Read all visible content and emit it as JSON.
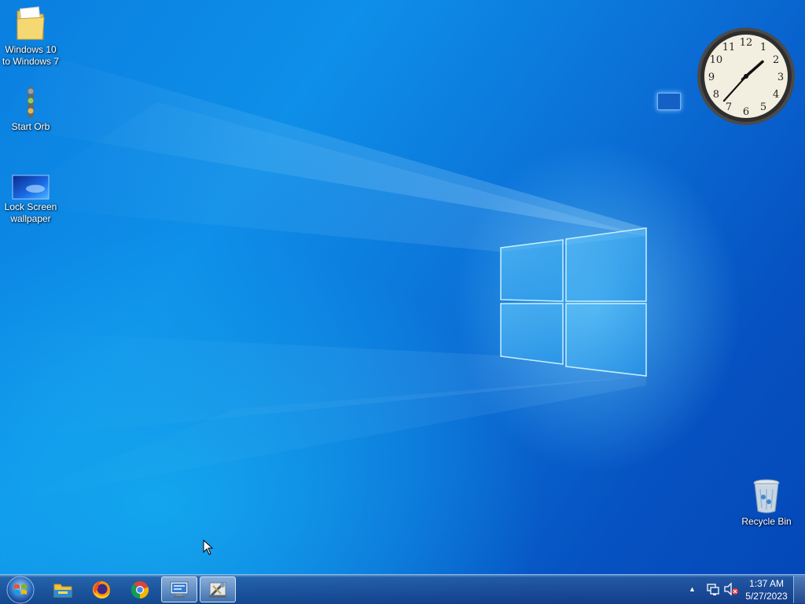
{
  "desktop": {
    "icons": [
      {
        "label": "Windows 10\nto Windows 7",
        "icon": "folder-icon"
      },
      {
        "label": "Start Orb",
        "icon": "traffic-light-icon"
      },
      {
        "label": "Lock Screen\nwallpaper",
        "icon": "image-thumbnail-icon"
      },
      {
        "label": "Recycle Bin",
        "icon": "recycle-bin-icon"
      }
    ]
  },
  "clock_gadget": {
    "numerals": [
      "12",
      "1",
      "2",
      "3",
      "4",
      "5",
      "6",
      "7",
      "8",
      "9",
      "10",
      "11"
    ],
    "hour": 1,
    "minute": 37
  },
  "taskbar": {
    "start_icon": "start-orb-icon",
    "pinned": [
      {
        "name": "File Explorer",
        "icon": "folder-icon"
      },
      {
        "name": "Firefox",
        "icon": "firefox-icon"
      },
      {
        "name": "Chrome",
        "icon": "chrome-icon"
      },
      {
        "name": "Remote Desktop",
        "icon": "remote-desktop-icon"
      },
      {
        "name": "Tools",
        "icon": "tools-icon"
      }
    ],
    "tray": {
      "time": "1:37 AM",
      "date": "5/27/2023",
      "icons": [
        "show-hidden-icon",
        "network-icon",
        "volume-muted-icon"
      ]
    }
  },
  "colors": {
    "wallpaper_dark": "#0447b8",
    "wallpaper_light": "#0e8fe8",
    "taskbar": "#143c82"
  }
}
